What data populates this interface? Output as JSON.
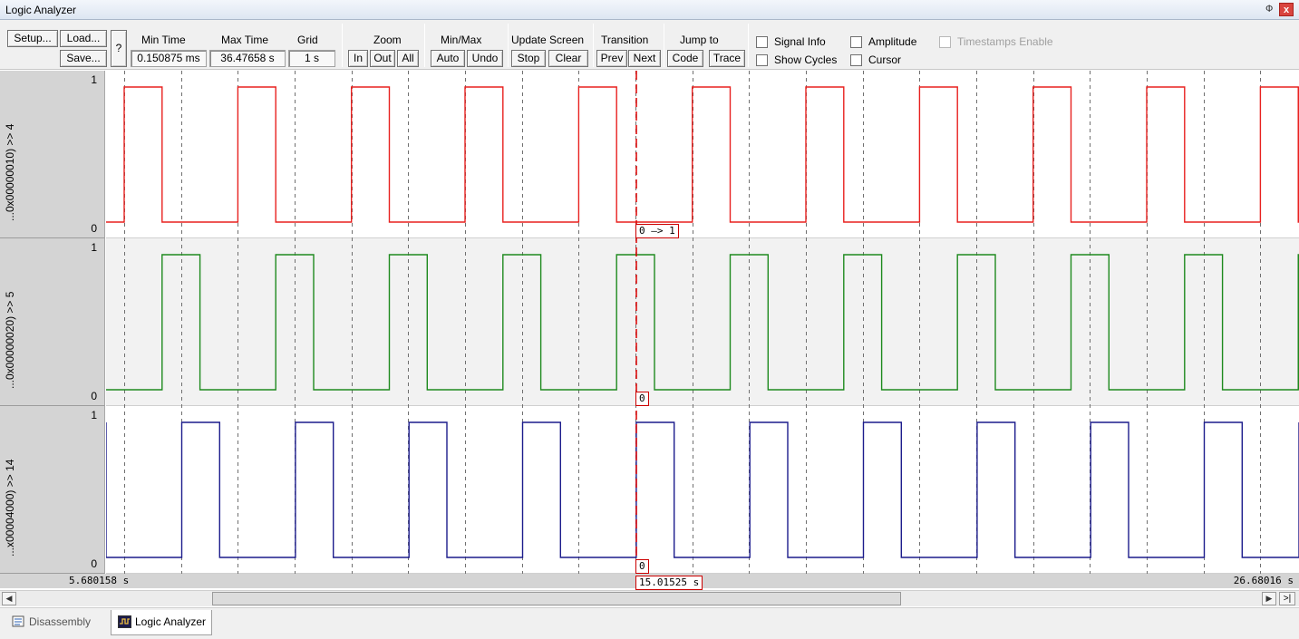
{
  "window": {
    "title": "Logic Analyzer",
    "pin_glyph": "Ф",
    "close_glyph": "x"
  },
  "toolbar": {
    "setup_label": "Setup...",
    "load_label": "Load...",
    "save_label": "Save...",
    "help_label": "?",
    "min_time": {
      "label": "Min Time",
      "value": "0.150875 ms"
    },
    "max_time": {
      "label": "Max Time",
      "value": "36.47658 s"
    },
    "grid": {
      "label": "Grid",
      "value": "1 s"
    },
    "zoom": {
      "label": "Zoom",
      "in": "In",
      "out": "Out",
      "all": "All"
    },
    "minmax": {
      "label": "Min/Max",
      "auto": "Auto",
      "undo": "Undo"
    },
    "update_screen": {
      "label": "Update Screen",
      "stop": "Stop",
      "clear": "Clear"
    },
    "transition": {
      "label": "Transition",
      "prev": "Prev",
      "next": "Next"
    },
    "jump_to": {
      "label": "Jump to",
      "code": "Code",
      "trace": "Trace"
    },
    "checkboxes": {
      "signal_info": "Signal Info",
      "amplitude": "Amplitude",
      "timestamps_enable": "Timestamps Enable",
      "show_cycles": "Show Cycles",
      "cursor": "Cursor"
    }
  },
  "signals": [
    {
      "name": "...0x00000010) >> 4",
      "high_label": "1",
      "low_label": "0",
      "color": "#e8211f",
      "cursor_value": "0 —> 1",
      "period_s": 2,
      "high_duration_s": 0.667,
      "first_rise_s": 6.0
    },
    {
      "name": "...0x00000020) >> 5",
      "high_label": "1",
      "low_label": "0",
      "color": "#1e8a1e",
      "cursor_value": "0",
      "period_s": 2,
      "high_duration_s": 0.667,
      "first_rise_s": 6.667
    },
    {
      "name": "...x00004000) >> 14",
      "high_label": "1",
      "low_label": "0",
      "color": "#1c1c8c",
      "cursor_value": "0",
      "period_s": 2,
      "high_duration_s": 0.667,
      "first_fall_s": 5.68
    }
  ],
  "time_axis": {
    "start_label": "5.680158 s",
    "end_label": "26.68016 s",
    "start_s": 5.680158,
    "end_s": 26.68016,
    "cursor_label": "15.01525 s",
    "cursor_s": 15.01525,
    "grid_s": 1
  },
  "tabs": [
    {
      "label": "Disassembly",
      "active": false
    },
    {
      "label": "Logic Analyzer",
      "active": true
    }
  ]
}
